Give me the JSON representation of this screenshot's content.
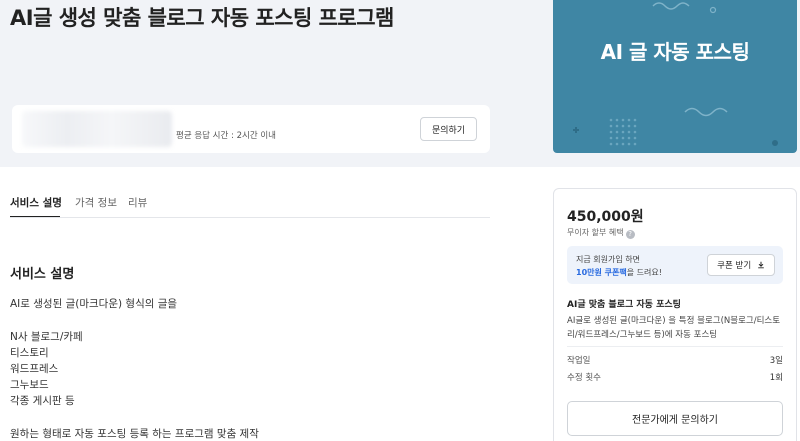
{
  "hero": {
    "title": "AI글 생성 맞춤 블로그 자동 포스팅 프로그램",
    "response_time": "평균 응답 시간 : 2시간 이내",
    "inquiry_button": "문의하기"
  },
  "thumbnail": {
    "text": "AI 글 자동 포스팅",
    "bg_color": "#3f86a4"
  },
  "tabs": [
    {
      "label": "서비스 설명",
      "active": true
    },
    {
      "label": "가격 정보",
      "active": false
    },
    {
      "label": "리뷰",
      "active": false
    }
  ],
  "description": {
    "title": "서비스 설명",
    "lines": [
      "AI로 생성된 글(마크다운) 형식의 글을",
      "N사 블로그/카페",
      "티스토리",
      "워드프레스",
      "그누보드",
      "각종 게시판 등",
      "원하는 형태로 자동 포스팅 등록 하는 프로그램 맞춤 제작"
    ]
  },
  "sidebar": {
    "price": "450,000원",
    "installment": "무이자 할부 혜택",
    "info_icon": "info-icon",
    "coupon": {
      "line1": "지금 회원가입 하면",
      "highlight": "10만원 쿠폰팩",
      "line2_suffix": "을 드려요!",
      "button": "쿠폰 받기",
      "button_icon": "download-icon",
      "accent": "#2a6be0"
    },
    "package_title": "AI글 맞춤 블로그 자동 포스팅",
    "package_desc": "AI글로 생성된 글(마크다운) 을 특정 블로그(N블로그/티스토리/워드프레스/그누보드 등)에 자동 포스팅",
    "meta": [
      {
        "key": "작업일",
        "value": "3일"
      },
      {
        "key": "수정 횟수",
        "value": "1회"
      }
    ],
    "inquiry_button": "전문가에게 문의하기"
  }
}
